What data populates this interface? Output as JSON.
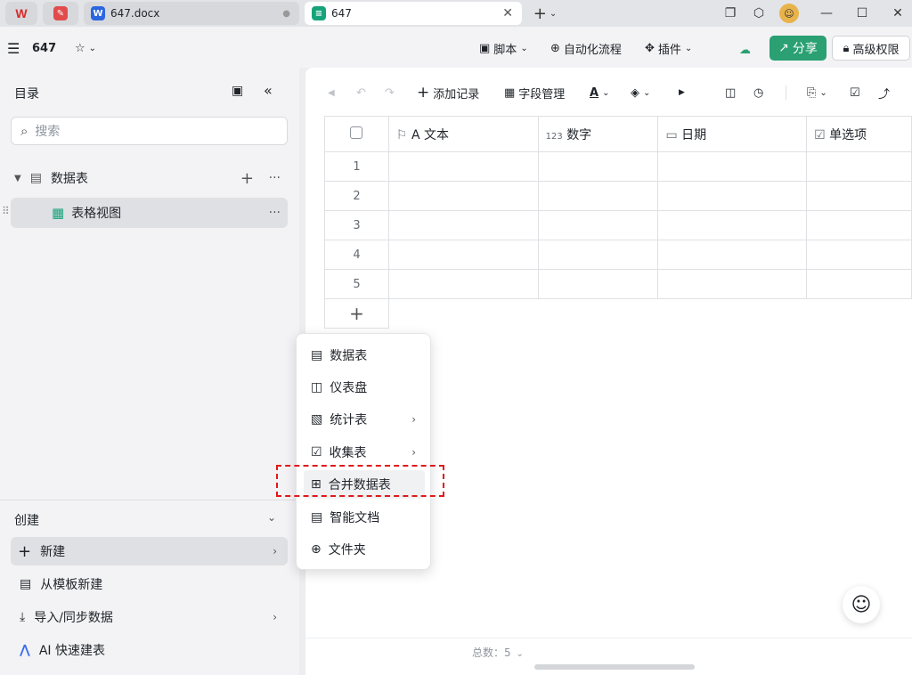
{
  "tabs": {
    "tab1": {
      "label": "647.docx"
    },
    "tab2": {
      "label": "647"
    }
  },
  "header": {
    "doc_title": "647",
    "script_label": "脚本",
    "automation_label": "自动化流程",
    "plugin_label": "插件",
    "share_label": "分享",
    "permission_label": "高级权限"
  },
  "sidebar": {
    "title": "目录",
    "search_placeholder": "搜索",
    "tree": {
      "table_label": "数据表",
      "view_label": "表格视图"
    },
    "create": {
      "title": "创建",
      "new_label": "新建",
      "template_label": "从模板新建",
      "import_label": "导入/同步数据",
      "ai_label": "AI 快速建表"
    }
  },
  "toolbar": {
    "add_record_label": "添加记录",
    "field_manage_label": "字段管理"
  },
  "grid": {
    "columns": [
      {
        "prefix": "A",
        "label": "文本"
      },
      {
        "prefix": "123",
        "label": "数字"
      },
      {
        "prefix": "",
        "label": "日期"
      },
      {
        "prefix": "",
        "label": "单选项"
      }
    ],
    "rows": [
      "1",
      "2",
      "3",
      "4",
      "5"
    ],
    "add_row": "+"
  },
  "footer": {
    "total_label": "总数：5"
  },
  "menu": {
    "items": [
      {
        "label": "数据表"
      },
      {
        "label": "仪表盘"
      },
      {
        "label": "统计表"
      },
      {
        "label": "收集表"
      },
      {
        "label": "合并数据表"
      },
      {
        "label": "智能文档"
      },
      {
        "label": "文件夹"
      }
    ]
  },
  "colors": {
    "accent": "#2aa073",
    "highlight_dashed": "#e0191b"
  }
}
